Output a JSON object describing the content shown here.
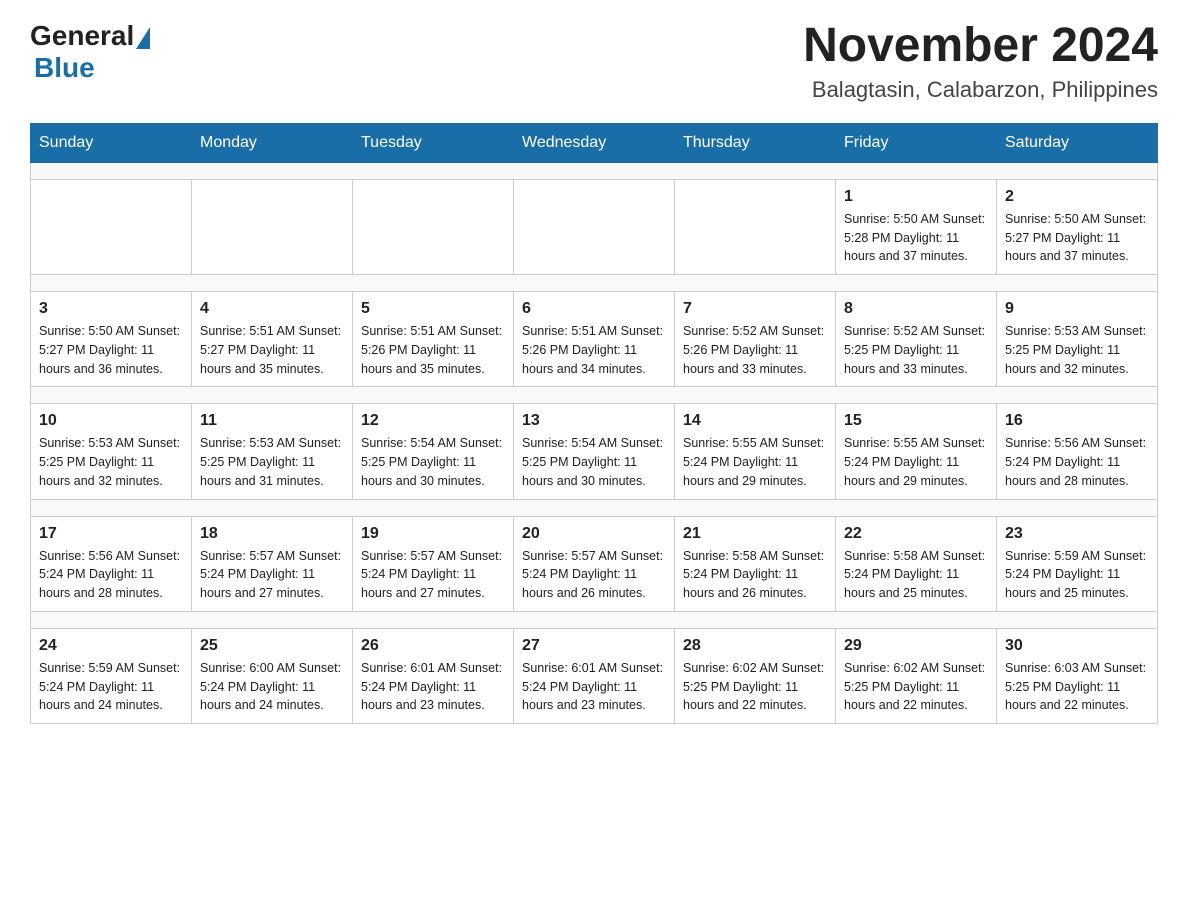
{
  "header": {
    "logo": {
      "general": "General",
      "blue": "Blue"
    },
    "title": "November 2024",
    "location": "Balagtasin, Calabarzon, Philippines"
  },
  "days_of_week": [
    "Sunday",
    "Monday",
    "Tuesday",
    "Wednesday",
    "Thursday",
    "Friday",
    "Saturday"
  ],
  "weeks": [
    {
      "days": [
        {
          "number": "",
          "info": ""
        },
        {
          "number": "",
          "info": ""
        },
        {
          "number": "",
          "info": ""
        },
        {
          "number": "",
          "info": ""
        },
        {
          "number": "",
          "info": ""
        },
        {
          "number": "1",
          "info": "Sunrise: 5:50 AM\nSunset: 5:28 PM\nDaylight: 11 hours and 37 minutes."
        },
        {
          "number": "2",
          "info": "Sunrise: 5:50 AM\nSunset: 5:27 PM\nDaylight: 11 hours and 37 minutes."
        }
      ]
    },
    {
      "days": [
        {
          "number": "3",
          "info": "Sunrise: 5:50 AM\nSunset: 5:27 PM\nDaylight: 11 hours and 36 minutes."
        },
        {
          "number": "4",
          "info": "Sunrise: 5:51 AM\nSunset: 5:27 PM\nDaylight: 11 hours and 35 minutes."
        },
        {
          "number": "5",
          "info": "Sunrise: 5:51 AM\nSunset: 5:26 PM\nDaylight: 11 hours and 35 minutes."
        },
        {
          "number": "6",
          "info": "Sunrise: 5:51 AM\nSunset: 5:26 PM\nDaylight: 11 hours and 34 minutes."
        },
        {
          "number": "7",
          "info": "Sunrise: 5:52 AM\nSunset: 5:26 PM\nDaylight: 11 hours and 33 minutes."
        },
        {
          "number": "8",
          "info": "Sunrise: 5:52 AM\nSunset: 5:25 PM\nDaylight: 11 hours and 33 minutes."
        },
        {
          "number": "9",
          "info": "Sunrise: 5:53 AM\nSunset: 5:25 PM\nDaylight: 11 hours and 32 minutes."
        }
      ]
    },
    {
      "days": [
        {
          "number": "10",
          "info": "Sunrise: 5:53 AM\nSunset: 5:25 PM\nDaylight: 11 hours and 32 minutes."
        },
        {
          "number": "11",
          "info": "Sunrise: 5:53 AM\nSunset: 5:25 PM\nDaylight: 11 hours and 31 minutes."
        },
        {
          "number": "12",
          "info": "Sunrise: 5:54 AM\nSunset: 5:25 PM\nDaylight: 11 hours and 30 minutes."
        },
        {
          "number": "13",
          "info": "Sunrise: 5:54 AM\nSunset: 5:25 PM\nDaylight: 11 hours and 30 minutes."
        },
        {
          "number": "14",
          "info": "Sunrise: 5:55 AM\nSunset: 5:24 PM\nDaylight: 11 hours and 29 minutes."
        },
        {
          "number": "15",
          "info": "Sunrise: 5:55 AM\nSunset: 5:24 PM\nDaylight: 11 hours and 29 minutes."
        },
        {
          "number": "16",
          "info": "Sunrise: 5:56 AM\nSunset: 5:24 PM\nDaylight: 11 hours and 28 minutes."
        }
      ]
    },
    {
      "days": [
        {
          "number": "17",
          "info": "Sunrise: 5:56 AM\nSunset: 5:24 PM\nDaylight: 11 hours and 28 minutes."
        },
        {
          "number": "18",
          "info": "Sunrise: 5:57 AM\nSunset: 5:24 PM\nDaylight: 11 hours and 27 minutes."
        },
        {
          "number": "19",
          "info": "Sunrise: 5:57 AM\nSunset: 5:24 PM\nDaylight: 11 hours and 27 minutes."
        },
        {
          "number": "20",
          "info": "Sunrise: 5:57 AM\nSunset: 5:24 PM\nDaylight: 11 hours and 26 minutes."
        },
        {
          "number": "21",
          "info": "Sunrise: 5:58 AM\nSunset: 5:24 PM\nDaylight: 11 hours and 26 minutes."
        },
        {
          "number": "22",
          "info": "Sunrise: 5:58 AM\nSunset: 5:24 PM\nDaylight: 11 hours and 25 minutes."
        },
        {
          "number": "23",
          "info": "Sunrise: 5:59 AM\nSunset: 5:24 PM\nDaylight: 11 hours and 25 minutes."
        }
      ]
    },
    {
      "days": [
        {
          "number": "24",
          "info": "Sunrise: 5:59 AM\nSunset: 5:24 PM\nDaylight: 11 hours and 24 minutes."
        },
        {
          "number": "25",
          "info": "Sunrise: 6:00 AM\nSunset: 5:24 PM\nDaylight: 11 hours and 24 minutes."
        },
        {
          "number": "26",
          "info": "Sunrise: 6:01 AM\nSunset: 5:24 PM\nDaylight: 11 hours and 23 minutes."
        },
        {
          "number": "27",
          "info": "Sunrise: 6:01 AM\nSunset: 5:24 PM\nDaylight: 11 hours and 23 minutes."
        },
        {
          "number": "28",
          "info": "Sunrise: 6:02 AM\nSunset: 5:25 PM\nDaylight: 11 hours and 22 minutes."
        },
        {
          "number": "29",
          "info": "Sunrise: 6:02 AM\nSunset: 5:25 PM\nDaylight: 11 hours and 22 minutes."
        },
        {
          "number": "30",
          "info": "Sunrise: 6:03 AM\nSunset: 5:25 PM\nDaylight: 11 hours and 22 minutes."
        }
      ]
    }
  ]
}
